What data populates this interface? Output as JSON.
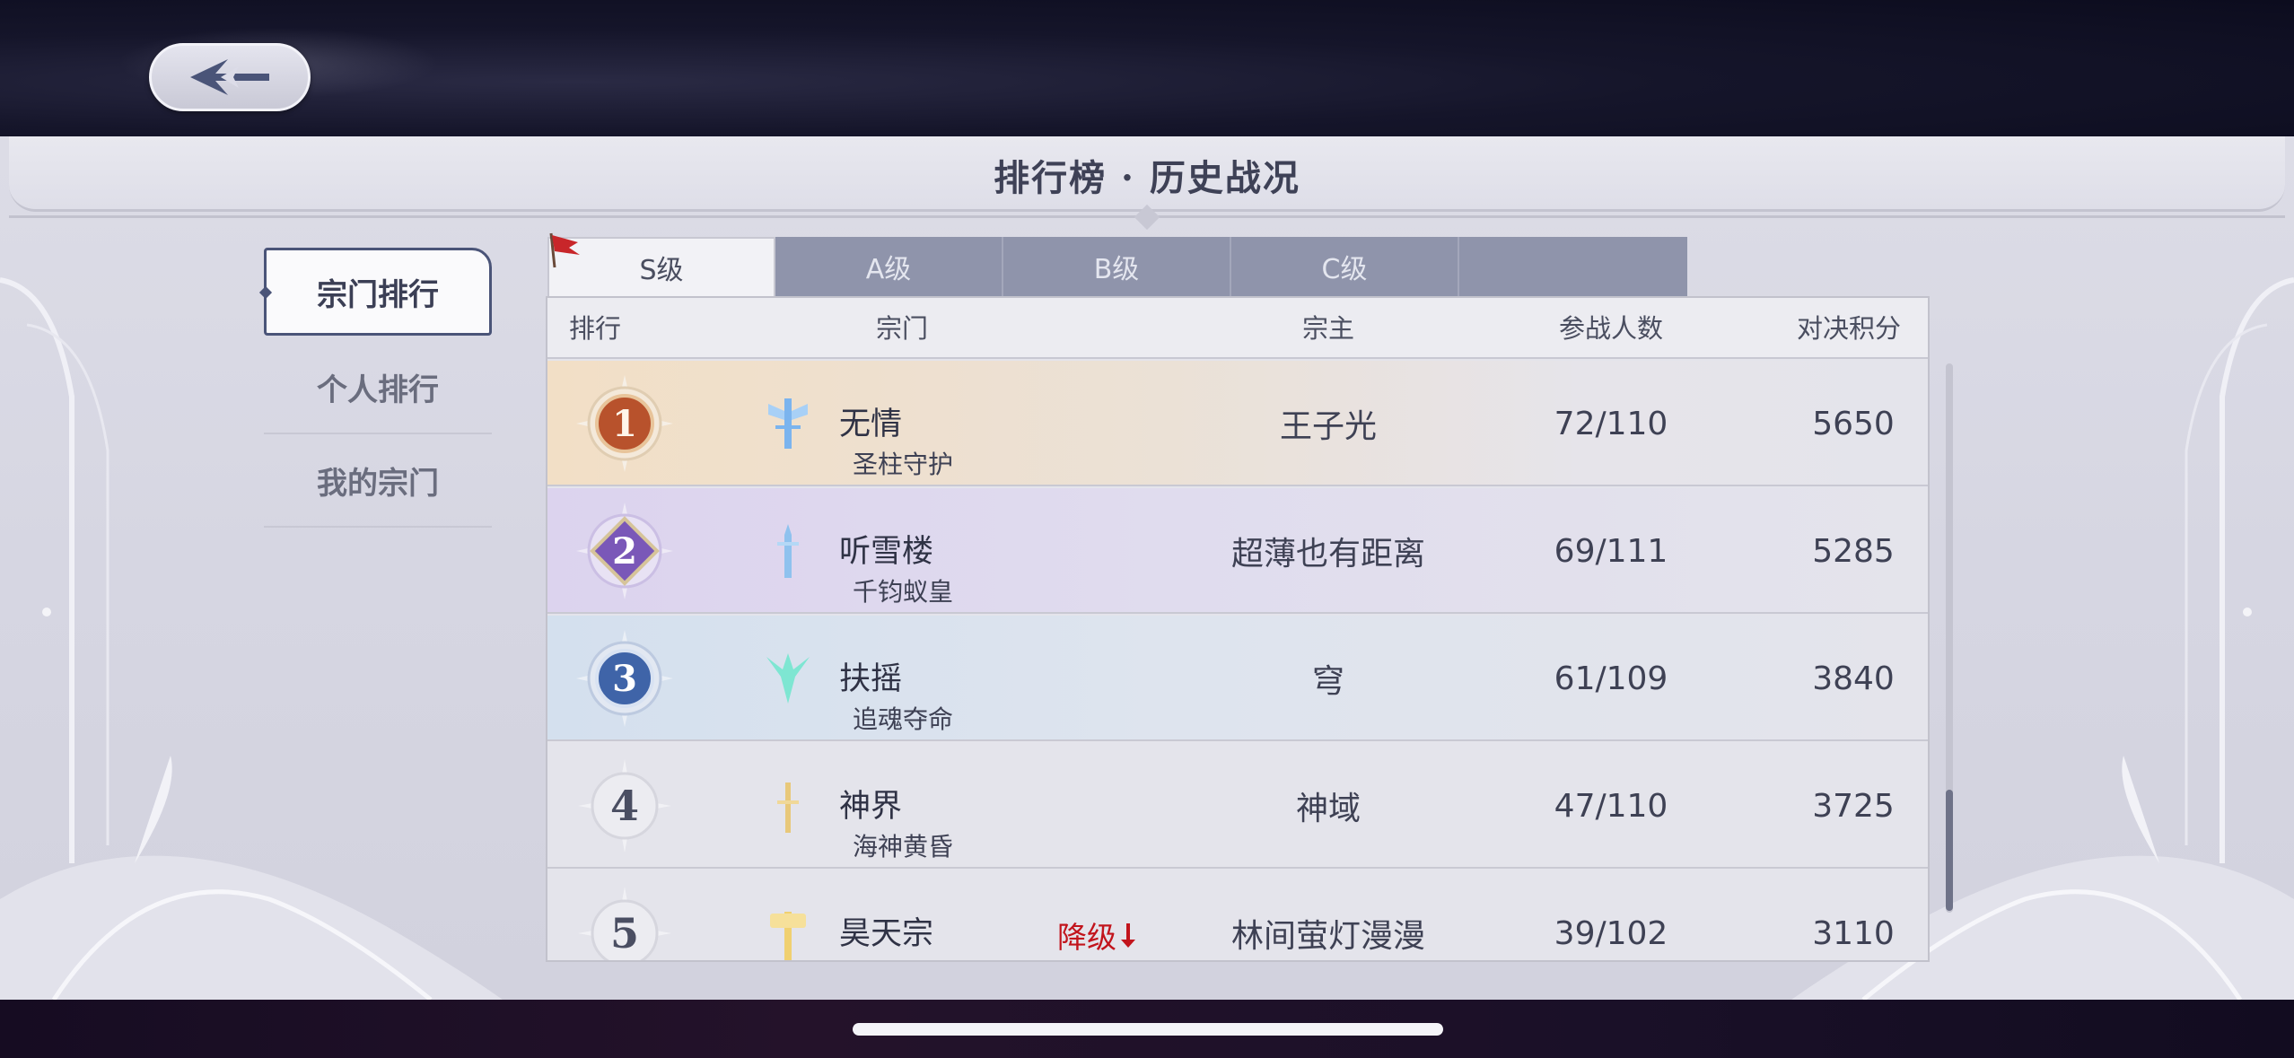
{
  "header": {
    "title": "排行榜 · 历史战况"
  },
  "side_tabs": [
    {
      "label": "宗门排行",
      "active": true
    },
    {
      "label": "个人排行",
      "active": false
    },
    {
      "label": "我的宗门",
      "active": false
    }
  ],
  "grade_tabs": [
    {
      "label": "S级",
      "active": true
    },
    {
      "label": "A级",
      "active": false
    },
    {
      "label": "B级",
      "active": false
    },
    {
      "label": "C级",
      "active": false
    },
    {
      "label": "",
      "active": false
    }
  ],
  "table": {
    "columns": [
      "排行",
      "宗门",
      "宗主",
      "参战人数",
      "对决积分"
    ],
    "rows": [
      {
        "rank": "1",
        "sect": "无情",
        "sub": "圣柱守护",
        "leader": "王子光",
        "members": "72/110",
        "score": "5650"
      },
      {
        "rank": "2",
        "sect": "听雪楼",
        "sub": "千钧蚁皇",
        "leader": "超薄也有距离",
        "members": "69/111",
        "score": "5285"
      },
      {
        "rank": "3",
        "sect": "扶摇",
        "sub": "追魂夺命",
        "leader": "穹",
        "members": "61/109",
        "score": "3840"
      },
      {
        "rank": "4",
        "sect": "神界",
        "sub": "海神黄昏",
        "leader": "神域",
        "members": "47/110",
        "score": "3725"
      },
      {
        "rank": "5",
        "sect": "昊天宗",
        "sub": "",
        "leader": "林间萤灯漫漫",
        "members": "39/102",
        "score": "3110",
        "badge": "降级"
      }
    ]
  },
  "colors": {
    "accent": "#4a5478",
    "demote": "#c2141c",
    "rank1": "#b8522c",
    "rank2": "#7a58b8",
    "rank3": "#3f64a8",
    "tab_inactive": "#8f94ab"
  },
  "icons": {
    "back": "back-arrow-icon",
    "flag": "red-flag-icon",
    "demote": "down-arrow-icon"
  }
}
